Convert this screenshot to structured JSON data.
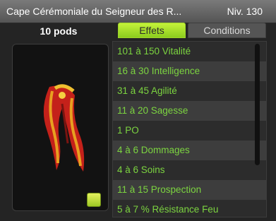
{
  "window": {
    "title": "Cape Cérémoniale du Seigneur des R...",
    "level": "Niv. 130"
  },
  "item": {
    "weight": "10 pods",
    "image_icon": "red-cape-image",
    "action_icon": "equip-icon"
  },
  "tabs": [
    {
      "label": "Effets",
      "active": true
    },
    {
      "label": "Conditions",
      "active": false
    }
  ],
  "effects": [
    "101 à 150 Vitalité",
    "16 à 30 Intelligence",
    "31 à 45 Agilité",
    "11 à 20 Sagesse",
    "1 PO",
    "4 à 6 Dommages",
    "4 à 6 Soins",
    "11 à 15 Prospection",
    "5 à 7 % Résistance Feu"
  ],
  "colors": {
    "accent": "#9fd42a",
    "effect_text": "#7cd440",
    "background": "#242424"
  }
}
